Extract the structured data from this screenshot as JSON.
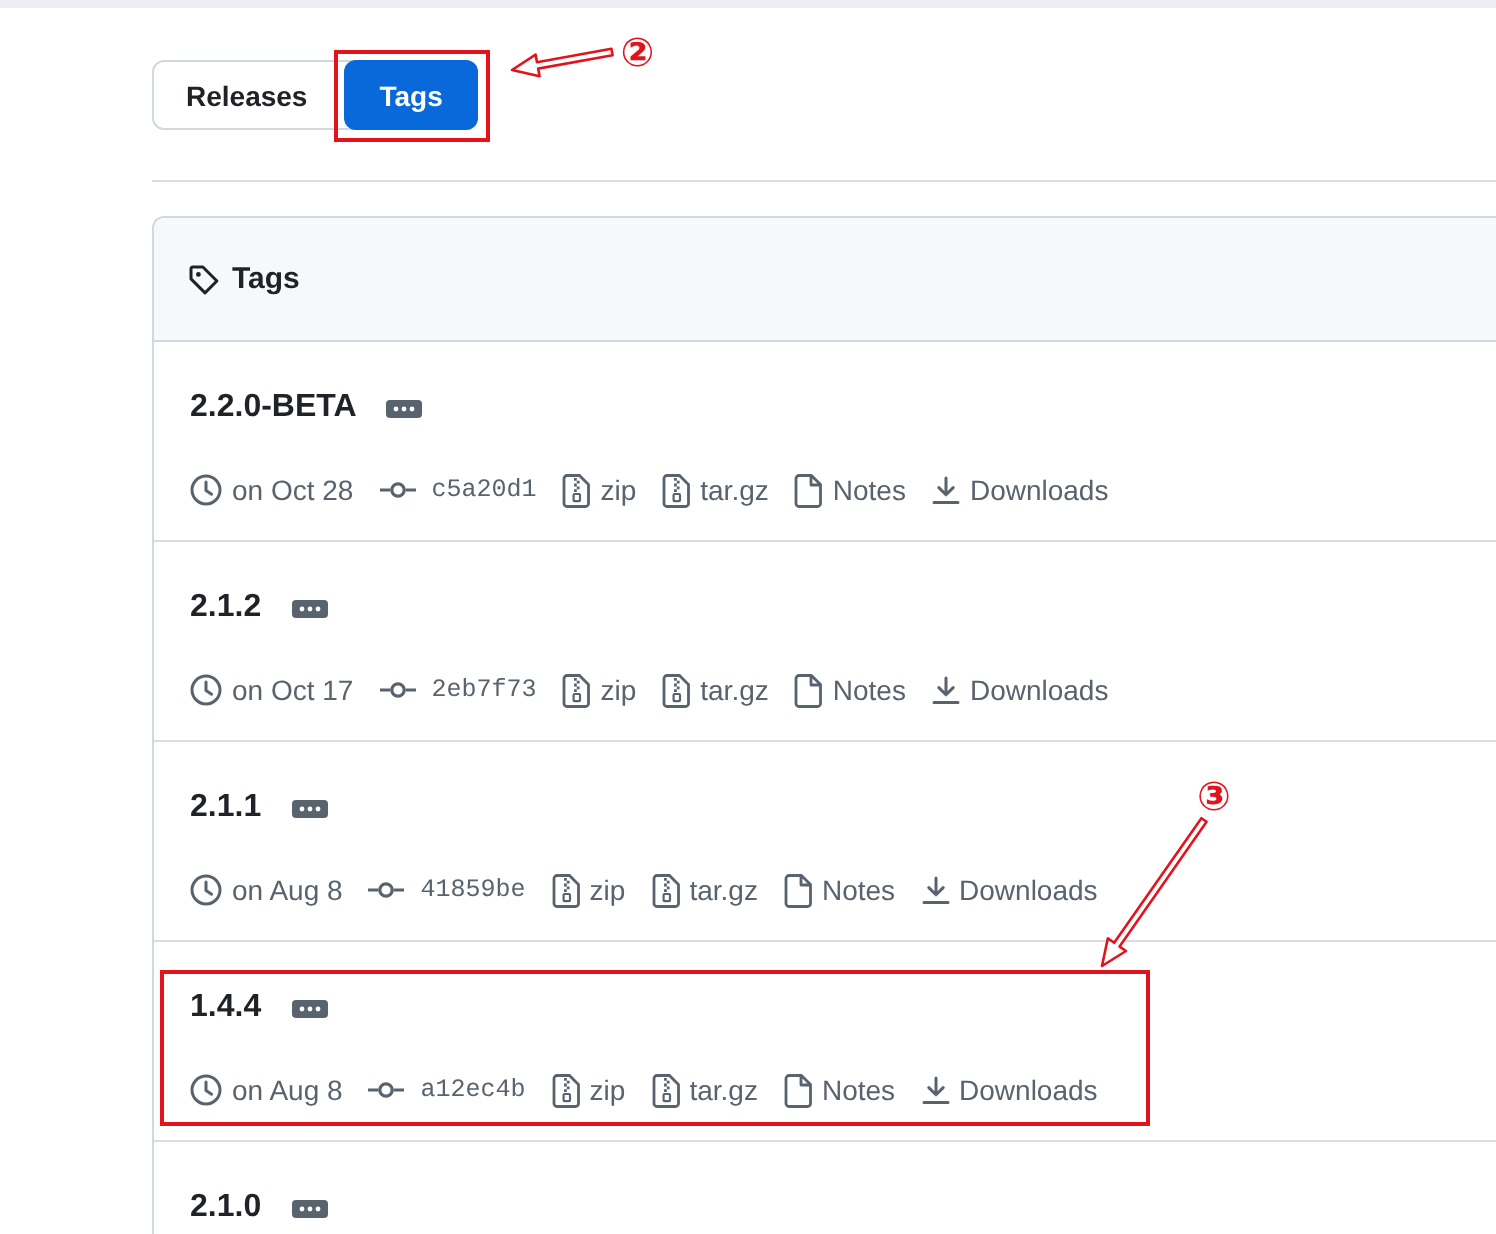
{
  "tabs": [
    {
      "label": "Releases",
      "selected": false,
      "highlighted": false
    },
    {
      "label": "Tags",
      "selected": true,
      "highlighted": true,
      "callout": "②"
    }
  ],
  "tag_list": {
    "title": "Tags",
    "tags": [
      {
        "name": "2.2.0-BETA",
        "date": "on Oct 28",
        "commit": "c5a20d1",
        "highlighted": false,
        "assets": [
          {
            "kind": "archive",
            "label": "zip"
          },
          {
            "kind": "archive",
            "label": "tar.gz"
          },
          {
            "kind": "notes",
            "label": "Notes"
          },
          {
            "kind": "downloads",
            "label": "Downloads"
          }
        ]
      },
      {
        "name": "2.1.2",
        "date": "on Oct 17",
        "commit": "2eb7f73",
        "highlighted": false,
        "assets": [
          {
            "kind": "archive",
            "label": "zip"
          },
          {
            "kind": "archive",
            "label": "tar.gz"
          },
          {
            "kind": "notes",
            "label": "Notes"
          },
          {
            "kind": "downloads",
            "label": "Downloads"
          }
        ]
      },
      {
        "name": "2.1.1",
        "date": "on Aug 8",
        "commit": "41859be",
        "highlighted": false,
        "assets": [
          {
            "kind": "archive",
            "label": "zip"
          },
          {
            "kind": "archive",
            "label": "tar.gz"
          },
          {
            "kind": "notes",
            "label": "Notes"
          },
          {
            "kind": "downloads",
            "label": "Downloads"
          }
        ]
      },
      {
        "name": "1.4.4",
        "date": "on Aug 8",
        "commit": "a12ec4b",
        "highlighted": true,
        "callout": "③",
        "assets": [
          {
            "kind": "archive",
            "label": "zip"
          },
          {
            "kind": "archive",
            "label": "tar.gz"
          },
          {
            "kind": "notes",
            "label": "Notes"
          },
          {
            "kind": "downloads",
            "label": "Downloads"
          }
        ]
      },
      {
        "name": "2.1.0",
        "highlighted": false
      }
    ]
  }
}
